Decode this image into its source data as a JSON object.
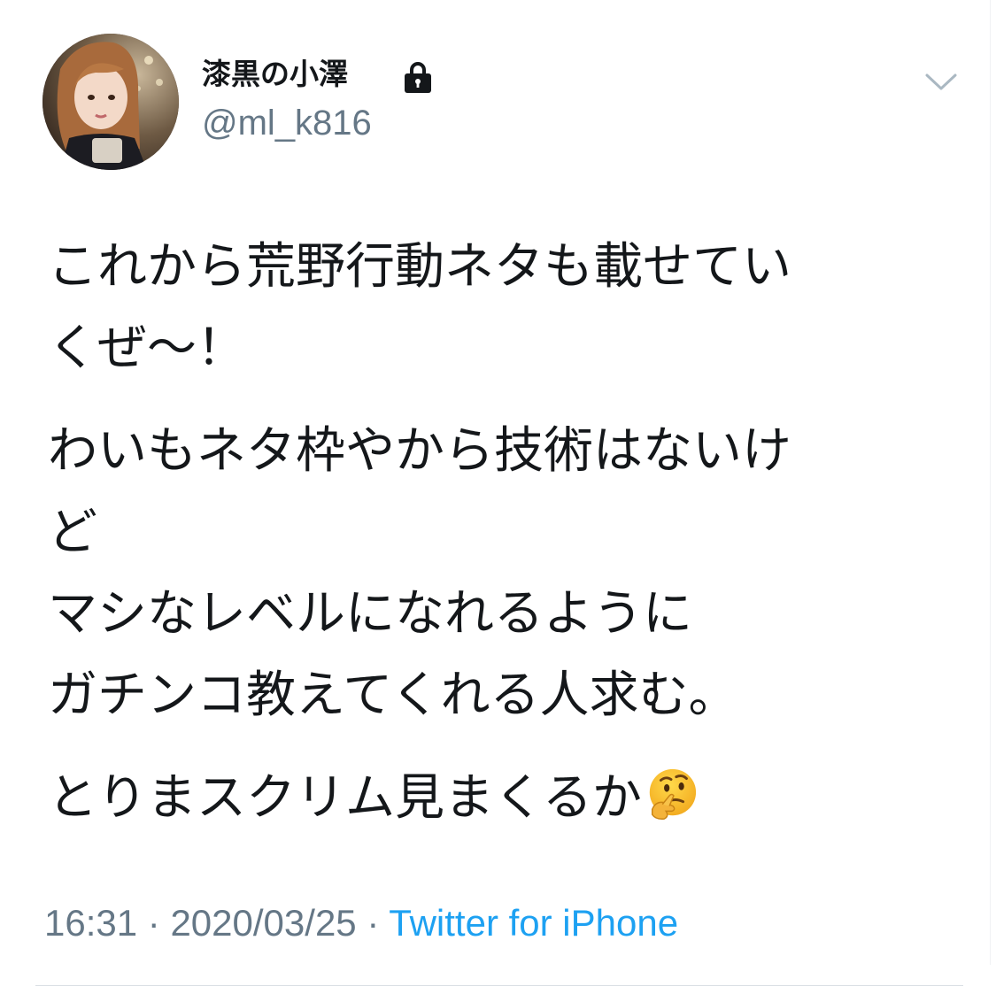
{
  "tweet": {
    "display_name": "漆黒の小澤",
    "handle": "@ml_k816",
    "protected_icon": "lock-icon",
    "menu_icon": "chevron-down-icon",
    "lines": [
      "これから荒野行動ネタも載せてい",
      "くぜ〜！",
      "わいもネタ枠やから技術はないけ",
      "ど",
      "マシなレベルになれるように",
      "ガチンコ教えてくれる人求む。",
      "とりまスクリム見まくるか"
    ],
    "emoji": "thinking-face-icon",
    "time": "16:31",
    "separator": "·",
    "date": "2020/03/25",
    "source": "Twitter for iPhone"
  },
  "colors": {
    "text": "#14171a",
    "secondary": "#657786",
    "link": "#1da1f2",
    "divider": "#d9dfe4"
  }
}
